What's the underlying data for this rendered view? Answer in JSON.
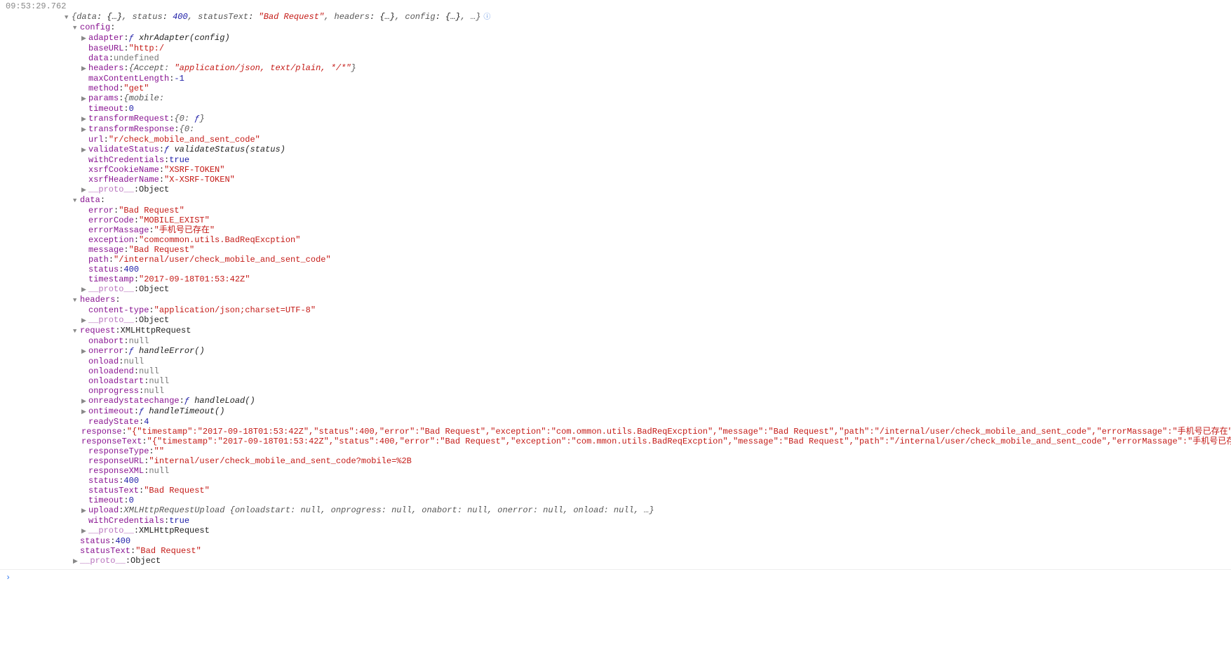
{
  "timestamp": "09:53:29.762",
  "rootPreview": {
    "open": "{",
    "data_k": "data",
    "data_v": "{…}",
    "status_k": "status",
    "status_v": "400",
    "statusText_k": "statusText",
    "statusText_v": "\"Bad Request\"",
    "headers_k": "headers",
    "headers_v": "{…}",
    "config_k": "config",
    "config_v": "{…}",
    "more": "…",
    "close": "}"
  },
  "config": {
    "label": "config",
    "adapter_k": "adapter",
    "adapter_v": "ƒ xhrAdapter(config)",
    "baseURL_k": "baseURL",
    "baseURL_v": "\"http:/",
    "baseURL_redact": "                    ",
    "data_k": "data",
    "data_v": "undefined",
    "headers_k": "headers",
    "headers_v": "{Accept: \"application/json, text/plain, */*\"}",
    "maxContentLength_k": "maxContentLength",
    "maxContentLength_v": "-1",
    "method_k": "method",
    "method_v": "\"get\"",
    "params_k": "params",
    "params_v": "{mobile: ",
    "params_redact": "                  ",
    "timeout_k": "timeout",
    "timeout_v": "0",
    "transformRequest_k": "transformRequest",
    "transformRequest_v": "{0: ƒ}",
    "transformResponse_k": "transformResponse",
    "transformResponse_v": "{0: ",
    "transformResponse_redact": "   ",
    "url_k": "url",
    "url_pre": "\"",
    "url_redact": "                                             ",
    "url_v": "r/check_mobile_and_sent_code\"",
    "validateStatus_k": "validateStatus",
    "validateStatus_v": "ƒ validateStatus(status)",
    "withCredentials_k": "withCredentials",
    "withCredentials_v": "true",
    "xsrfCookieName_k": "xsrfCookieName",
    "xsrfCookieName_v": "\"XSRF-TOKEN\"",
    "xsrfHeaderName_k": "xsrfHeaderName",
    "xsrfHeaderName_v": "\"X-XSRF-TOKEN\"",
    "proto_k": "__proto__",
    "proto_v": "Object"
  },
  "data": {
    "label": "data",
    "error_k": "error",
    "error_v": "\"Bad Request\"",
    "errorCode_k": "errorCode",
    "errorCode_v": "\"MOBILE_EXIST\"",
    "errorMassage_k": "errorMassage",
    "errorMassage_v": "\"手机号已存在\"",
    "exception_k": "exception",
    "exception_pre": "\"com",
    "exception_redact": "        ",
    "exception_v": "common.utils.BadReqExcption\"",
    "message_k": "message",
    "message_v": "\"Bad Request\"",
    "path_k": "path",
    "path_v": "\"/internal/user/check_mobile_and_sent_code\"",
    "status_k": "status",
    "status_v": "400",
    "ts_k": "timestamp",
    "ts_v": "\"2017-09-18T01:53:42Z\"",
    "proto_k": "__proto__",
    "proto_v": "Object"
  },
  "headers": {
    "label": "headers",
    "ct_k": "content-type",
    "ct_v": "\"application/json;charset=UTF-8\"",
    "proto_k": "__proto__",
    "proto_v": "Object"
  },
  "request": {
    "label": "request",
    "label_v": "XMLHttpRequest",
    "onabort_k": "onabort",
    "onabort_v": "null",
    "onerror_k": "onerror",
    "onerror_v": "ƒ handleError()",
    "onload_k": "onload",
    "onload_v": "null",
    "onloadend_k": "onloadend",
    "onloadend_v": "null",
    "onloadstart_k": "onloadstart",
    "onloadstart_v": "null",
    "onprogress_k": "onprogress",
    "onprogress_v": "null",
    "onreadystatechange_k": "onreadystatechange",
    "onreadystatechange_v": "ƒ handleLoad()",
    "ontimeout_k": "ontimeout",
    "ontimeout_v": "ƒ handleTimeout()",
    "readyState_k": "readyState",
    "readyState_v": "4",
    "response_k": "response",
    "response_v1": "\"{\"timestamp\":\"2017-09-18T01:53:42Z\",\"status\":400,\"error\":\"Bad Request\",\"exception\":\"com.",
    "response_redact": "          ",
    "response_v2": "ommon.utils.BadReqExcption\",\"message\":\"Bad Request\",\"path\":\"/internal/user/check_mobile_and_sent_code\",\"errorMassage\":\"手机号已存在\",\"err",
    "responseText_k": "responseText",
    "responseText_v1": "\"{\"timestamp\":\"2017-09-18T01:53:42Z\",\"status\":400,\"error\":\"Bad Request\",\"exception\":\"com.",
    "responseText_redact": "          ",
    "responseText_v2": "mmon.utils.BadReqExcption\",\"message\":\"Bad Request\",\"path\":\"/internal/user/check_mobile_and_sent_code\",\"errorMassage\":\"手机号已存在\",",
    "responseType_k": "responseType",
    "responseType_v": "\"\"",
    "responseURL_k": "responseURL",
    "responseURL_pre": "\"",
    "responseURL_redact": "                                        ",
    "responseURL_v": "internal/user/check_mobile_and_sent_code?mobile=%2B",
    "responseURL_redact2": "              ",
    "responseXML_k": "responseXML",
    "responseXML_v": "null",
    "status_k": "status",
    "status_v": "400",
    "statusText_k": "statusText",
    "statusText_v": "\"Bad Request\"",
    "timeout_k": "timeout",
    "timeout_v": "0",
    "upload_k": "upload",
    "upload_v": "XMLHttpRequestUpload {onloadstart: null, onprogress: null, onabort: null, onerror: null, onload: null, …}",
    "withCredentials_k": "withCredentials",
    "withCredentials_v": "true",
    "proto_k": "__proto__",
    "proto_v": "XMLHttpRequest"
  },
  "tail": {
    "status_k": "status",
    "status_v": "400",
    "statusText_k": "statusText",
    "statusText_v": "\"Bad Request\"",
    "proto_k": "__proto__",
    "proto_v": "Object"
  },
  "glyphs": {
    "down": "▼",
    "right": "▶",
    "info": "ⓘ",
    "prompt": "›"
  }
}
